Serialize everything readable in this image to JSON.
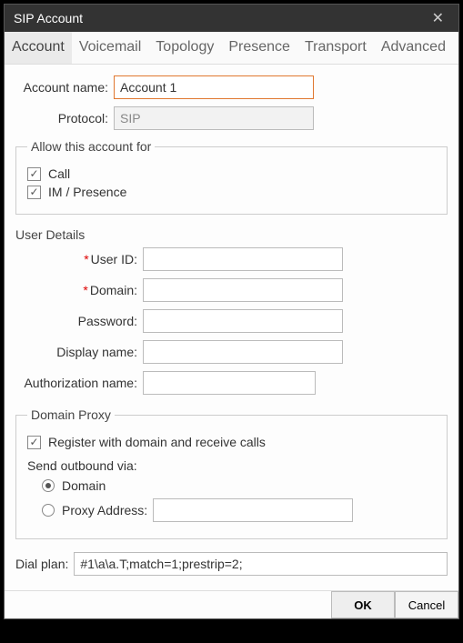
{
  "window": {
    "title": "SIP Account"
  },
  "tabs": {
    "items": [
      {
        "label": "Account"
      },
      {
        "label": "Voicemail"
      },
      {
        "label": "Topology"
      },
      {
        "label": "Presence"
      },
      {
        "label": "Transport"
      },
      {
        "label": "Advanced"
      }
    ],
    "active_index": 0
  },
  "account": {
    "name_label": "Account name:",
    "name_value": "Account 1",
    "protocol_label": "Protocol:",
    "protocol_value": "SIP"
  },
  "allow_group": {
    "legend": "Allow this account for",
    "call_label": "Call",
    "call_checked": true,
    "im_label": "IM / Presence",
    "im_checked": true
  },
  "user_details": {
    "header": "User Details",
    "user_id_label": "User ID:",
    "user_id_value": "",
    "domain_label": "Domain:",
    "domain_value": "",
    "password_label": "Password:",
    "password_value": "",
    "display_name_label": "Display name:",
    "display_name_value": "",
    "auth_name_label": "Authorization name:",
    "auth_name_value": ""
  },
  "domain_proxy": {
    "legend": "Domain Proxy",
    "register_label": "Register with domain and receive calls",
    "register_checked": true,
    "send_via_label": "Send outbound via:",
    "domain_radio_label": "Domain",
    "proxy_radio_label": "Proxy  Address:",
    "proxy_value": "",
    "selected": "domain"
  },
  "dial_plan": {
    "label": "Dial plan:",
    "value": "#1\\a\\a.T;match=1;prestrip=2;"
  },
  "footer": {
    "ok_label": "OK",
    "cancel_label": "Cancel"
  }
}
